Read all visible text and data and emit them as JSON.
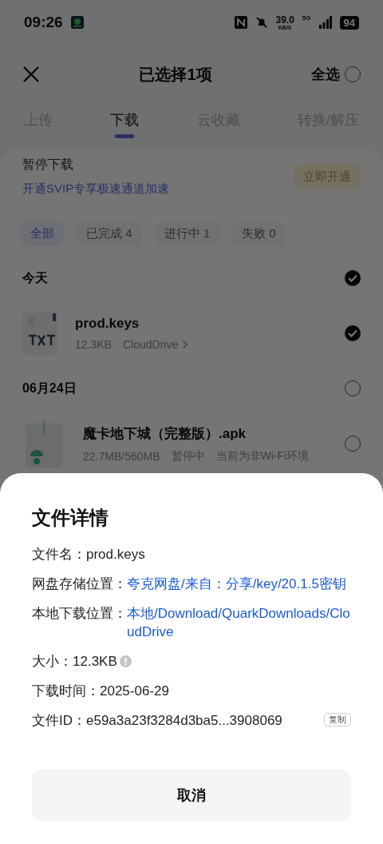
{
  "status_bar": {
    "time": "09:26",
    "speed": "39.0",
    "speed_unit": "KB/S",
    "network": "5G",
    "battery": "94"
  },
  "header": {
    "title": "已选择1项",
    "select_all": "全选",
    "all_selected": false
  },
  "tabs": [
    {
      "label": "上传",
      "selected": false
    },
    {
      "label": "下载",
      "selected": true
    },
    {
      "label": "云收藏",
      "selected": false
    },
    {
      "label": "转换/解压",
      "selected": false
    }
  ],
  "banner": {
    "title": "暂停下载",
    "subtitle": "开通SVIP专享极速通道加速",
    "button": "立即开通"
  },
  "filters": [
    {
      "label": "全部",
      "selected": true
    },
    {
      "label": "已完成 4",
      "selected": false
    },
    {
      "label": "进行中 1",
      "selected": false
    },
    {
      "label": "失败 0",
      "selected": false
    }
  ],
  "groups": [
    {
      "title": "今天",
      "checked": true,
      "items": [
        {
          "name": "prod.keys",
          "kind": "txt",
          "size": "12.3KB",
          "location": "CloudDrive",
          "checked": true
        }
      ]
    },
    {
      "title": "06月24日",
      "checked": false,
      "items": [
        {
          "name": "魔卡地下城（完整版）.apk",
          "kind": "apk",
          "size": "22.7MB/560MB",
          "status": "暂停中",
          "note": "当前为非Wi-Fi环境",
          "checked": false
        }
      ]
    }
  ],
  "sheet": {
    "title": "文件详情",
    "rows": [
      {
        "kind": "text",
        "label": "文件名：",
        "value": "prod.keys"
      },
      {
        "kind": "link",
        "label": "网盘存储位置：",
        "value": "夸克网盘/来自：分享/key/20.1.5密钥"
      },
      {
        "kind": "link",
        "label": "本地下载位置：",
        "value": "本地/Download/QuarkDownloads/CloudDrive"
      },
      {
        "kind": "info",
        "label": "大小：",
        "value": "12.3KB"
      },
      {
        "kind": "text",
        "label": "下载时间：",
        "value": "2025-06-29"
      },
      {
        "kind": "copy",
        "label": "文件ID：",
        "value": "e59a3a23f3284d3ba5...3908069",
        "action": "复制"
      }
    ],
    "cancel": "取消"
  }
}
